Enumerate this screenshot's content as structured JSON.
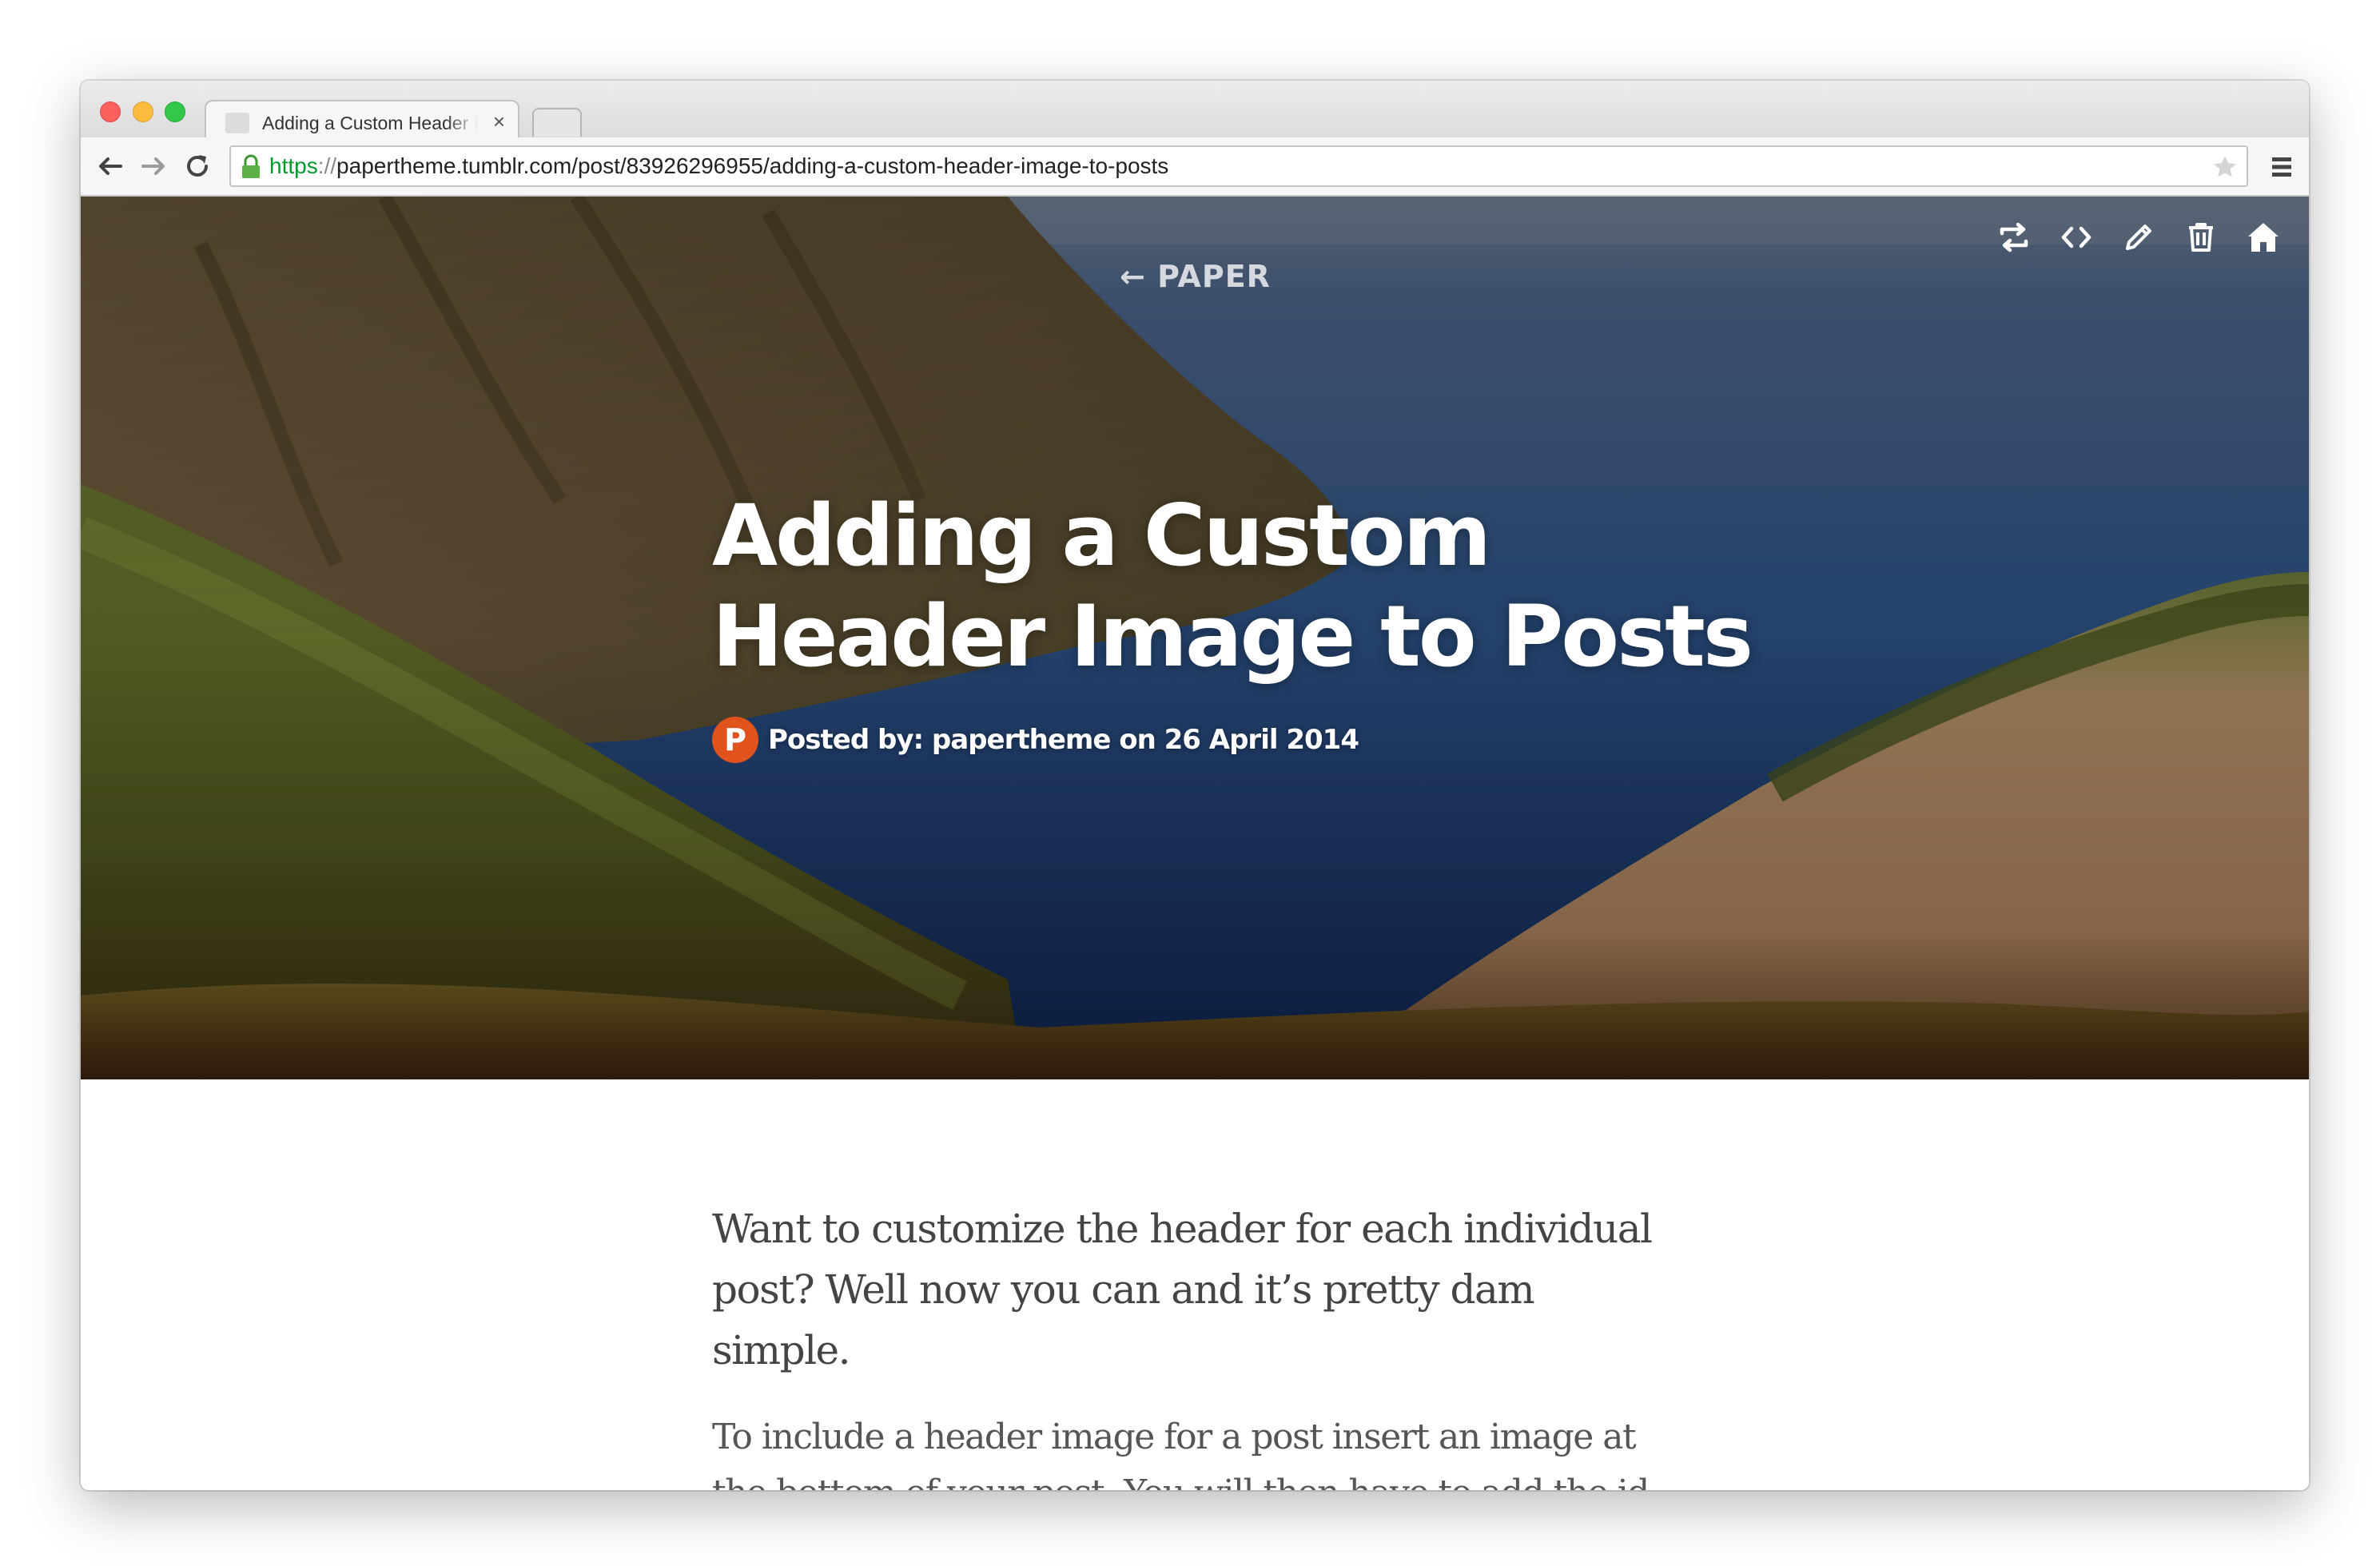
{
  "browser": {
    "tab_title": "Adding a Custom Header Image to Posts",
    "tab_close": "×",
    "url_scheme": "https",
    "url_sep": "://",
    "url_rest": "papertheme.tumblr.com/post/83926296955/adding-a-custom-header-image-to-posts"
  },
  "toolbar_icons": [
    "back-arrow-icon",
    "forward-arrow-icon",
    "reload-icon",
    "lock-icon",
    "star-icon",
    "hamburger-menu-icon"
  ],
  "post_tools": [
    "reblog-icon",
    "embed-code-icon",
    "edit-pencil-icon",
    "delete-trash-icon",
    "home-icon"
  ],
  "page": {
    "back_link": "← PAPER",
    "title": "Adding a Custom Header Image to Posts",
    "avatar_letter": "P",
    "byline": "Posted by: papertheme on 26 April 2014",
    "lede": "Want to customize the header for each individual post? Well now you can and it’s pretty dam simple.",
    "paragraph": "To include a header image for a post insert an image at the bottom of your post. You will then have to add the id of “splash” to that image. Once this is done your image will"
  },
  "colors": {
    "accent_avatar": "#e0531d",
    "url_scheme": "#009a2e",
    "sea": "#1f3a63"
  }
}
